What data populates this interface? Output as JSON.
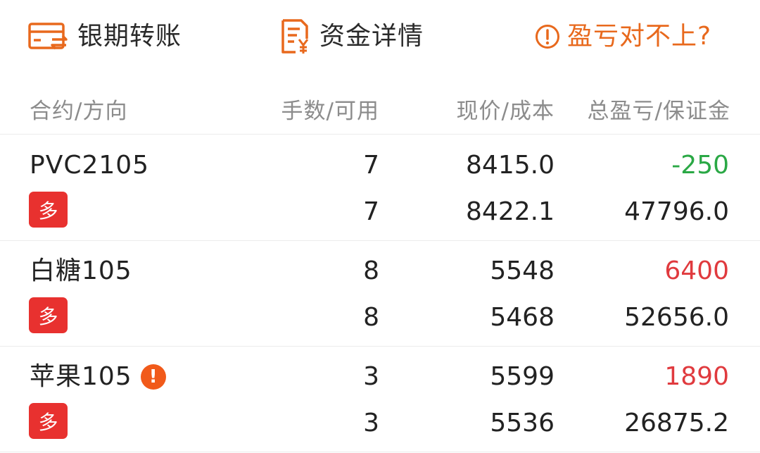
{
  "actions": {
    "transfer": {
      "label": "银期转账",
      "icon": "bank-transfer-icon"
    },
    "funds": {
      "label": "资金详情",
      "icon": "fund-document-icon"
    },
    "help": {
      "label": "盈亏对不上?",
      "icon": "alert-circle-icon"
    }
  },
  "colors": {
    "accent": "#e8691d",
    "long_badge": "#e8312f",
    "profit": "#e03a3e",
    "loss": "#2aa845",
    "header_text": "#8c8c8c",
    "warning": "#f15a1a"
  },
  "table": {
    "headers": [
      "合约/方向",
      "手数/可用",
      "现价/成本",
      "总盈亏/保证金"
    ],
    "rows": [
      {
        "contract": "PVC2105",
        "direction": "多",
        "warning": false,
        "lots": "7",
        "available": "7",
        "price": "8415.0",
        "cost": "8422.1",
        "pnl": "-250",
        "pnl_sign": "negative",
        "margin": "47796.0"
      },
      {
        "contract": "白糖105",
        "direction": "多",
        "warning": false,
        "lots": "8",
        "available": "8",
        "price": "5548",
        "cost": "5468",
        "pnl": "6400",
        "pnl_sign": "positive",
        "margin": "52656.0"
      },
      {
        "contract": "苹果105",
        "direction": "多",
        "warning": true,
        "warning_mark": "!",
        "lots": "3",
        "available": "3",
        "price": "5599",
        "cost": "5536",
        "pnl": "1890",
        "pnl_sign": "positive",
        "margin": "26875.2"
      }
    ]
  }
}
